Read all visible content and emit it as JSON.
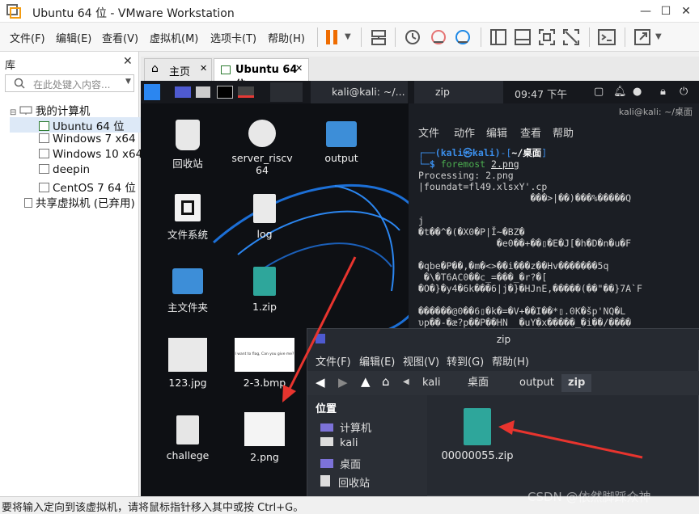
{
  "window": {
    "title": "Ubuntu 64 位 - VMware Workstation",
    "controls": [
      "—",
      "☐",
      "✕"
    ]
  },
  "menu": [
    "文件(F)",
    "编辑(E)",
    "查看(V)",
    "虚拟机(M)",
    "选项卡(T)",
    "帮助(H)"
  ],
  "library": {
    "title": "库",
    "search_placeholder": "在此处键入内容...",
    "tree": [
      {
        "label": "我的计算机",
        "level": 0
      },
      {
        "label": "Ubuntu 64 位",
        "level": 1
      },
      {
        "label": "Windows 7 x64",
        "level": 1
      },
      {
        "label": "Windows 10 x64",
        "level": 1
      },
      {
        "label": "deepin",
        "level": 1
      },
      {
        "label": "CentOS 7 64 位",
        "level": 1
      },
      {
        "label": "共享虚拟机 (已弃用)",
        "level": 0
      }
    ]
  },
  "tabs": [
    {
      "label": "主页",
      "icon": "home-icon"
    },
    {
      "label": "Ubuntu 64 位",
      "icon": "vm-icon",
      "active": true
    }
  ],
  "guest": {
    "topbar": {
      "task1": "kali@kali: ~/...",
      "task2": "zip",
      "clock": "09:47 下午"
    },
    "desktop_icons": [
      {
        "label": "回收站"
      },
      {
        "label": "server_riscv64"
      },
      {
        "label": "output"
      },
      {
        "label": "文件系统"
      },
      {
        "label": "log"
      },
      {
        "label": "主文件夹"
      },
      {
        "label": "1.zip"
      },
      {
        "label": "123.jpg"
      },
      {
        "label": "2-3.bmp"
      },
      {
        "label": "challege"
      },
      {
        "label": "2.png"
      }
    ],
    "bmp_thumb_text": "I want to flag, Can you give me?",
    "terminal": {
      "title": "kali@kali: ~/桌面",
      "menu": [
        "文件",
        "动作",
        "编辑",
        "查看",
        "帮助"
      ],
      "prompt_user": "(kali㉿kali)",
      "prompt_path": "~/桌面",
      "command_bin": "foremost",
      "command_arg": "2.png",
      "lines": [
        "Processing: 2.png",
        "|foundat=fl49.xlsxY'.cp",
        "                    ���>|��)���%�����Q",
        "",
        "j",
        "�t��^�(�X0�P|Ĭ~�BZ�",
        "              �e0��+��▯�E�J[�h�D�n�u�F",
        "",
        "�qbe�P��,�m�<>��i���z��Hv�������5q",
        " �\\�T6AC0��c_=���_�r?�[",
        "�O�}�y4�6k���6|j�}�HJnE,�����(��\"��}7A`F",
        "",
        "������@0��6▯�k�=�V+��I��*▯.0K�šp'NQ�L",
        "υp��-�æ?p��P��HN  �uY�x�����_�i��/����"
      ]
    },
    "file_manager": {
      "title": "zip",
      "menu": [
        "文件(F)",
        "编辑(E)",
        "视图(V)",
        "转到(G)",
        "帮助(H)"
      ],
      "breadcrumbs": [
        "kali",
        "桌面",
        "output",
        "zip"
      ],
      "places_header": "位置",
      "places": [
        "计算机",
        "kali",
        "桌面",
        "回收站"
      ],
      "files": [
        {
          "label": "00000055.zip"
        }
      ]
    }
  },
  "status": "要将输入定向到该虚拟机，请将鼠标指针移入其中或按 Ctrl+G。",
  "watermark": "CSDN @依然脚踩众神",
  "colors": {
    "arrow": "#e8342e",
    "accent": "#1e88e5",
    "folder": "#3d8ed8",
    "zip": "#2ea69b"
  }
}
